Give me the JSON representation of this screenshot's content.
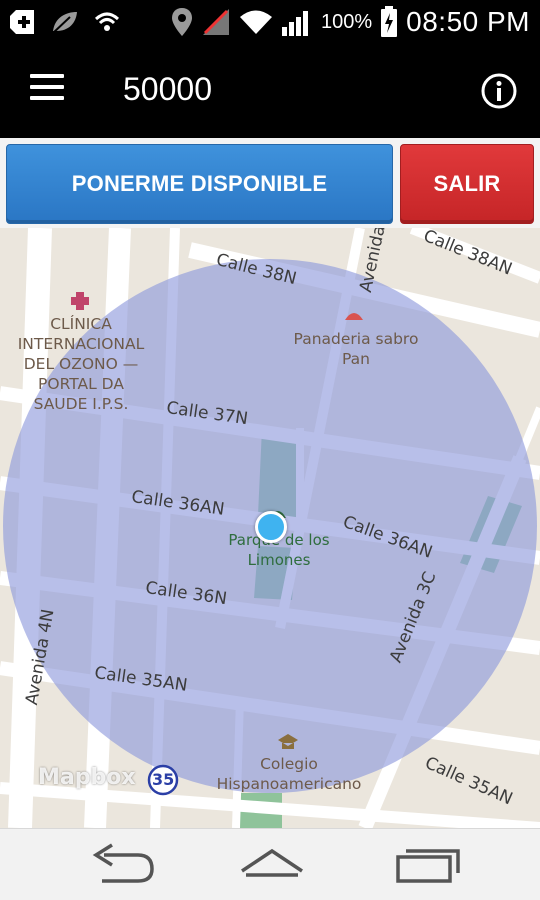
{
  "status_bar": {
    "battery": "100%",
    "time": "08:50 PM",
    "icons": [
      "add-notification-icon",
      "leaf-icon",
      "wifi-alt-icon",
      "location-icon",
      "signal-off-icon",
      "wifi-icon",
      "signal-bars-icon",
      "battery-charging-icon"
    ]
  },
  "app_bar": {
    "title": "50000",
    "menu_icon": "hamburger-menu-icon",
    "info_icon": "info-icon"
  },
  "actions": {
    "available_label": "PONERME DISPONIBLE",
    "exit_label": "SALIR",
    "available_color": "#3185d1",
    "exit_color": "#d42f31"
  },
  "map": {
    "streets": {
      "calle_38n": "Calle 38N",
      "calle_38an": "Calle 38AN",
      "calle_37n": "Calle 37N",
      "calle_36an_left": "Calle 36AN",
      "calle_36an_right": "Calle 36AN",
      "calle_36n": "Calle 36N",
      "calle_35an_left": "Calle 35AN",
      "calle_35an_right": "Calle 35AN",
      "avenida_4n": "Avenida 4N",
      "avenida_3c": "Avenida 3C",
      "avenida_top": "Avenida"
    },
    "pois": {
      "clinic": "CLÍNICA\nINTERNACIONAL\nDEL OZONO —\nPORTAL DA\nSAUDE I.P.S.",
      "bakery": "Panaderia sabro\nPan",
      "park": "Parque de los\nLimones",
      "school": "Colegio\nHispanoamericano"
    },
    "route_shield": "35",
    "watermark": "Mapbox",
    "radius_color": "#8c98dc"
  },
  "nav_bar": {
    "icons": [
      "back-icon",
      "home-icon",
      "recent-apps-icon"
    ]
  }
}
